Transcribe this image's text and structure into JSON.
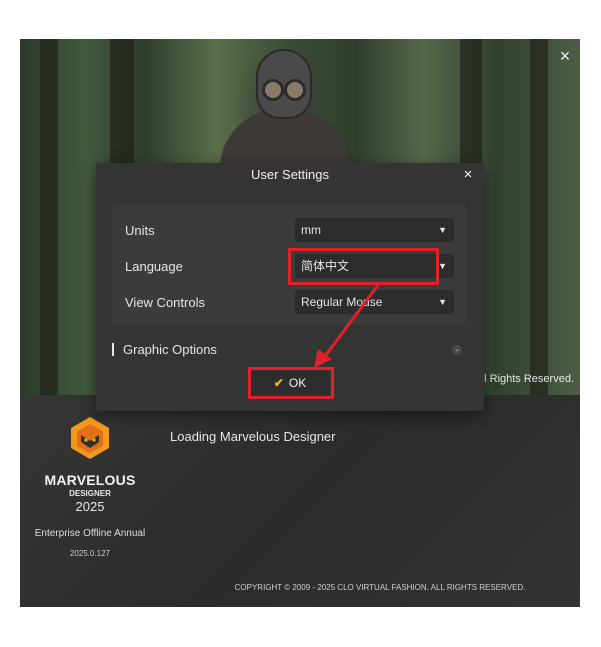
{
  "splash": {
    "close_icon": "×",
    "rights_text": "All Rights Reserved.",
    "loading_text": "Loading Marvelous Designer",
    "brand_name": "MARVELOUS",
    "brand_sub": "DESIGNER",
    "brand_year": "2025",
    "edition": "Enterprise Offline Annual",
    "build": "2025.0.127",
    "copyright": "COPYRIGHT © 2009 - 2025 CLO VIRTUAL FASHION. ALL RIGHTS RESERVED."
  },
  "dialog": {
    "title": "User Settings",
    "close_icon": "×",
    "rows": [
      {
        "label": "Units",
        "value": "mm"
      },
      {
        "label": "Language",
        "value": "简体中文"
      },
      {
        "label": "View Controls",
        "value": "Regular Mouse"
      }
    ],
    "caret_icon": "▼",
    "graphic_options_label": "Graphic Options",
    "expand_icon": "⌄",
    "ok_check": "✔",
    "ok_label": "OK"
  },
  "colors": {
    "highlight": "#e0202a",
    "check": "#f2b01e",
    "dialog_bg": "#343434"
  },
  "icons": [
    "close-icon",
    "chevron-down-icon",
    "check-icon",
    "marvelous-logo-icon"
  ]
}
